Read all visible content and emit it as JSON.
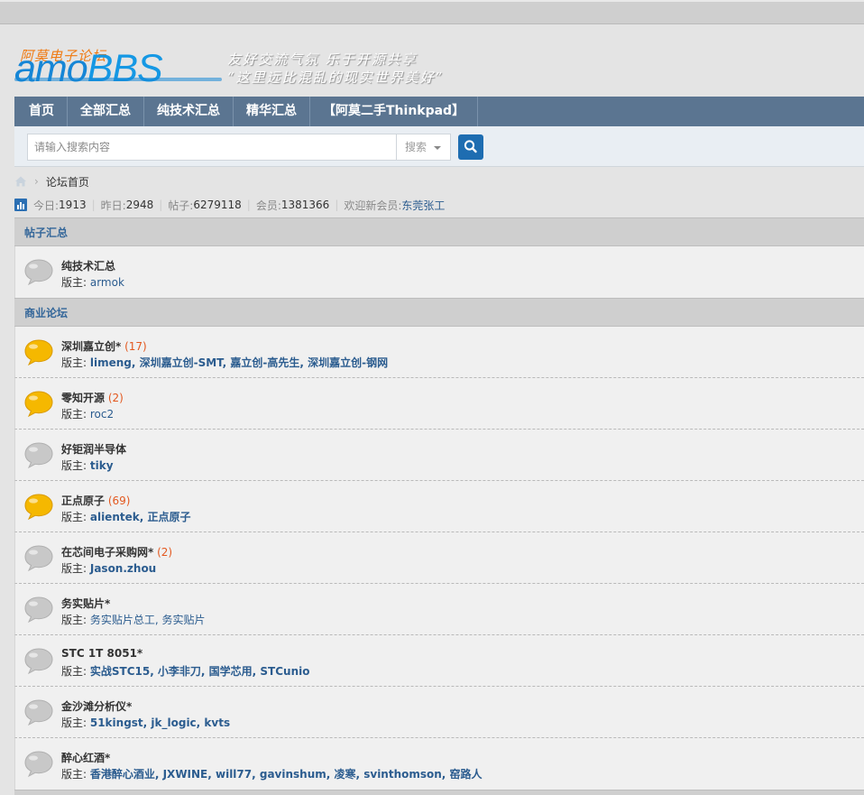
{
  "logo": {
    "cn": "阿莫电子论坛",
    "amo": "amo",
    "bbs": "BBS",
    "slogan_1": "友好交流气氛  乐于开源共享",
    "slogan_2": "“这里远比混乱的现实世界美好”"
  },
  "nav": {
    "items": [
      "首页",
      "全部汇总",
      "纯技术汇总",
      "精华汇总",
      "【阿莫二手Thinkpad】"
    ]
  },
  "search": {
    "placeholder": "请输入搜索内容",
    "type_label": "搜索"
  },
  "breadcrumb": {
    "separator": "›",
    "current": "论坛首页"
  },
  "stats": {
    "today_label": "今日: ",
    "today": "1913",
    "yesterday_label": "昨日: ",
    "yesterday": "2948",
    "posts_label": "帖子: ",
    "posts": "6279118",
    "members_label": "会员: ",
    "members": "1381366",
    "welcome_label": "欢迎新会员: ",
    "newest_member": "东莞张工"
  },
  "colors": {
    "nav_bg": "#5b7591",
    "link": "#2b5c8f",
    "count": "#e3581f",
    "bubble_new": "#f5b800",
    "bubble_old": "#c8c8c8"
  },
  "sections": [
    {
      "title": "帖子汇总",
      "forums": [
        {
          "name": "纯技术汇总",
          "count": "",
          "mod_label": "版主: ",
          "mods": "armok",
          "mods_bold": false,
          "new": false
        }
      ]
    },
    {
      "title": "商业论坛",
      "forums": [
        {
          "name": "深圳嘉立创*",
          "count": " (17)",
          "mod_label": "版主: ",
          "mods": "limeng, 深圳嘉立创-SMT, 嘉立创-高先生, 深圳嘉立创-钢网",
          "mods_bold": true,
          "new": true
        },
        {
          "name": "零知开源",
          "count": " (2)",
          "mod_label": "版主: ",
          "mods": "roc2",
          "mods_bold": false,
          "new": true
        },
        {
          "name": "好钜润半导体",
          "count": "",
          "mod_label": "版主: ",
          "mods": "tiky",
          "mods_bold": true,
          "new": false
        },
        {
          "name": "正点原子",
          "count": " (69)",
          "mod_label": "版主: ",
          "mods": "alientek, 正点原子",
          "mods_bold": true,
          "new": true
        },
        {
          "name": "在芯间电子采购网*",
          "count": " (2)",
          "mod_label": "版主: ",
          "mods": "Jason.zhou",
          "mods_bold": true,
          "new": false
        },
        {
          "name": "务实贴片*",
          "count": "",
          "mod_label": "版主: ",
          "mods": "务实贴片总工, 务实贴片",
          "mods_bold": false,
          "new": false
        },
        {
          "name": "STC 1T 8051*",
          "count": "",
          "mod_label": "版主: ",
          "mods": "实战STC15, 小李非刀, 国学芯用, STCunio",
          "mods_bold": true,
          "new": false
        },
        {
          "name": "金沙滩分析仪*",
          "count": "",
          "mod_label": "版主: ",
          "mods": "51kingst, jk_logic, kvts",
          "mods_bold": true,
          "new": false
        },
        {
          "name": "醉心红酒*",
          "count": "",
          "mod_label": "版主: ",
          "mods": "香港醉心酒业, JXWINE, will77, gavinshum, 凌寒, svinthomson, 窑路人",
          "mods_bold": true,
          "new": false
        }
      ]
    }
  ]
}
